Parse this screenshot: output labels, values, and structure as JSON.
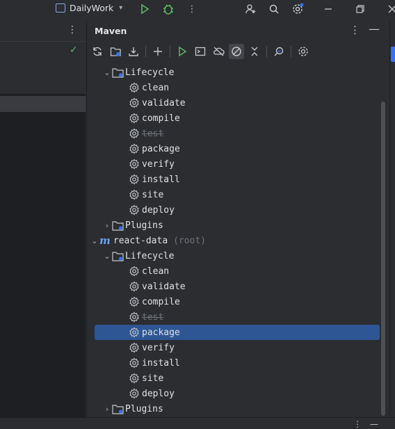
{
  "titlebar": {
    "project": "DailyWork",
    "icons": [
      "run-icon",
      "debug-icon",
      "more-vertical-icon",
      "add-user-icon",
      "search-icon",
      "settings-icon",
      "minimize-icon",
      "restore-icon",
      "close-icon"
    ]
  },
  "maven": {
    "title": "Maven",
    "toolbar": [
      "reload-icon",
      "add-project-icon",
      "download-icon",
      "plus-icon",
      "run-icon",
      "execute-goal-icon",
      "offline-icon",
      "skip-tests-icon",
      "collapse-icon",
      "analyze-icon",
      "settings-icon"
    ],
    "tree": {
      "lifecycle_label": "Lifecycle",
      "plugins_label": "Plugins",
      "project_name": "react-data",
      "project_suffix": "(root)",
      "goals": [
        "clean",
        "validate",
        "compile",
        "test",
        "package",
        "verify",
        "install",
        "site",
        "deploy"
      ],
      "skipped_goal": "test",
      "selected_goal": "package"
    }
  },
  "colors": {
    "selection": "#2e5694",
    "accent": "#3574f0",
    "check": "#5fb865"
  }
}
